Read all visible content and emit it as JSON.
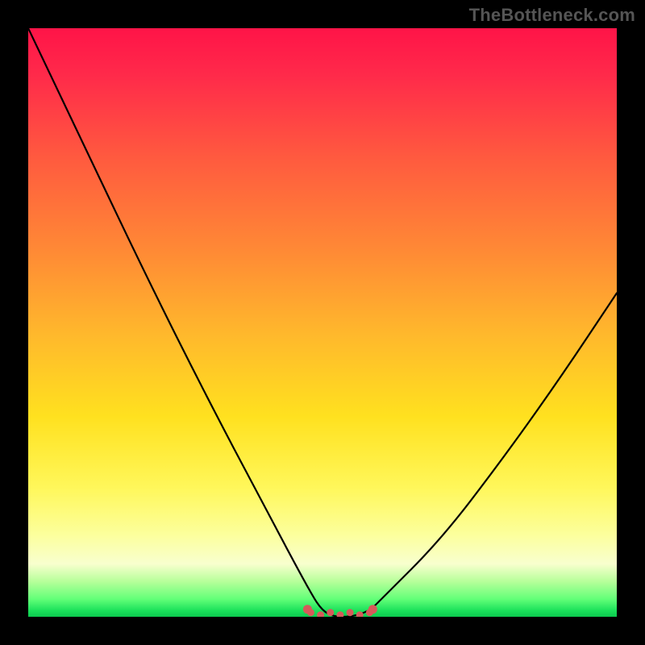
{
  "watermark": "TheBottleneck.com",
  "chart_data": {
    "type": "line",
    "title": "",
    "xlabel": "",
    "ylabel": "",
    "xlim": [
      0,
      100
    ],
    "ylim": [
      0,
      100
    ],
    "grid": false,
    "series": [
      {
        "name": "curve",
        "x": [
          0,
          10,
          20,
          30,
          40,
          48,
          50,
          52,
          55,
          58,
          60,
          70,
          80,
          90,
          100
        ],
        "values": [
          100,
          79,
          58,
          38,
          19,
          4,
          1,
          0,
          0,
          1,
          3,
          13,
          26,
          40,
          55
        ]
      }
    ],
    "annotations": [
      {
        "name": "bottom-dot-cluster",
        "x_range": [
          48,
          58
        ],
        "y": 1
      }
    ],
    "background_gradient": {
      "direction": "vertical",
      "stops": [
        {
          "pos": 0.0,
          "color": "#ff1448"
        },
        {
          "pos": 0.5,
          "color": "#ffb82c"
        },
        {
          "pos": 0.8,
          "color": "#fff75a"
        },
        {
          "pos": 0.97,
          "color": "#62ff78"
        },
        {
          "pos": 1.0,
          "color": "#0cc94f"
        }
      ]
    }
  }
}
